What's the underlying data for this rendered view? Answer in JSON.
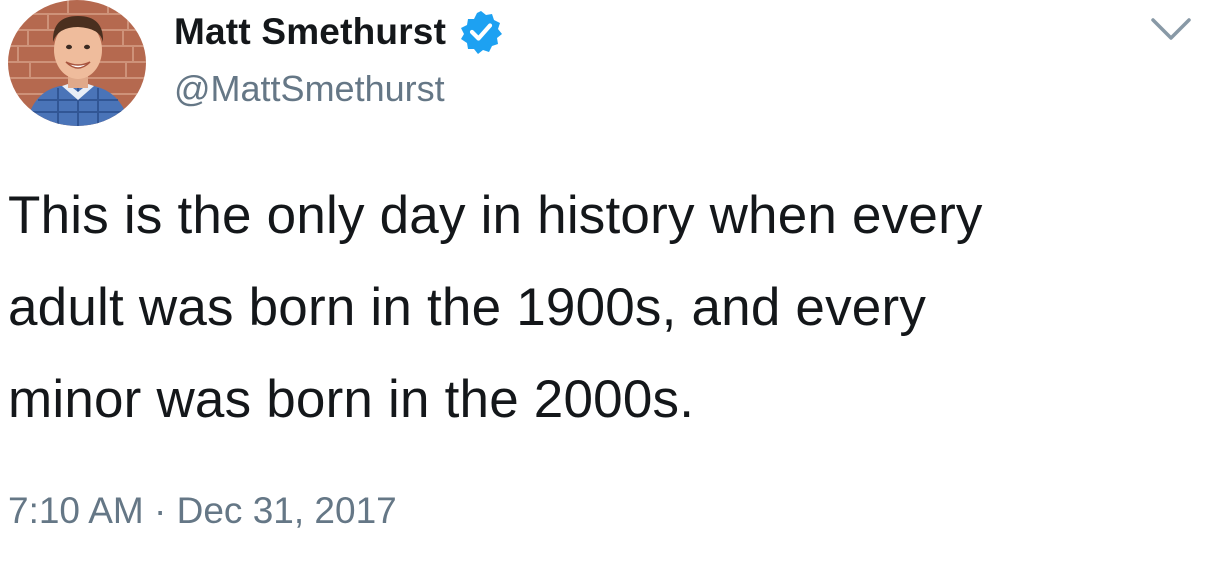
{
  "author": {
    "display_name": "Matt Smethurst",
    "handle": "@MattSmethurst",
    "verified": true
  },
  "tweet": {
    "text": "This is the only day in history when every\nadult was born in the 1900s, and every\nminor was born in the 2000s.",
    "timestamp": "7:10 AM · Dec 31, 2017"
  },
  "icons": {
    "verified": "verified-badge-icon",
    "menu": "chevron-down-icon"
  },
  "colors": {
    "text_primary": "#14171a",
    "text_secondary": "#657786",
    "verified_blue": "#1da1f2"
  }
}
